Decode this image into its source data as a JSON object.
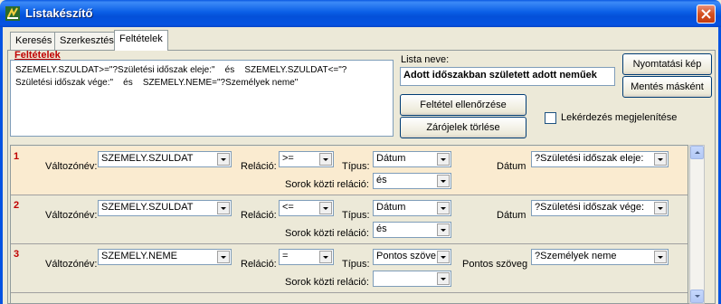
{
  "window": {
    "title": "Listakészítő",
    "close_icon": "close-icon"
  },
  "tabs": [
    {
      "label": "Keresés",
      "active": false
    },
    {
      "label": "Szerkesztés",
      "active": false
    },
    {
      "label": "Feltételek",
      "active": true
    }
  ],
  "conditions": {
    "group_label": "Feltételek",
    "text": "SZEMELY.SZULDAT>=\"?Születési időszak eleje:\"    és    SZEMELY.SZULDAT<=\"?\nSzületési időszak vége:\"    és    SZEMELY.NEME=\"?Személyek neme\""
  },
  "list_name": {
    "label": "Lista neve:",
    "value": "Adott időszakban született adott neműek"
  },
  "buttons": {
    "print_view": "Nyomtatási kép",
    "save_as": "Mentés másként",
    "check_condition": "Feltétel ellenőrzése",
    "clear_brackets": "Zárójelek törlése"
  },
  "show_query": {
    "label": "Lekérdezés megjelenítése",
    "checked": false
  },
  "labels": {
    "variable_name": "Változónév:",
    "relation": "Reláció:",
    "type": "Típus:",
    "row_relation": "Sorok közti reláció:"
  },
  "rows": [
    {
      "num": "1",
      "variable": "SZEMELY.SZULDAT",
      "relation": ">=",
      "type": "Dátum",
      "value_label": "Dátum",
      "value": "?Születési időszak eleje:",
      "row_relation": "és",
      "highlighted": true
    },
    {
      "num": "2",
      "variable": "SZEMELY.SZULDAT",
      "relation": "<=",
      "type": "Dátum",
      "value_label": "Dátum",
      "value": "?Születési időszak vége:",
      "row_relation": "és",
      "highlighted": false
    },
    {
      "num": "3",
      "variable": "SZEMELY.NEME",
      "relation": "=",
      "type": "Pontos szöve",
      "value_label": "Pontos szöveg",
      "value": "?Személyek neme",
      "row_relation": "",
      "highlighted": false
    }
  ],
  "colors": {
    "titlebar": "#0553e2",
    "accent_label": "#c00000",
    "highlight_row": "#faebd0"
  }
}
